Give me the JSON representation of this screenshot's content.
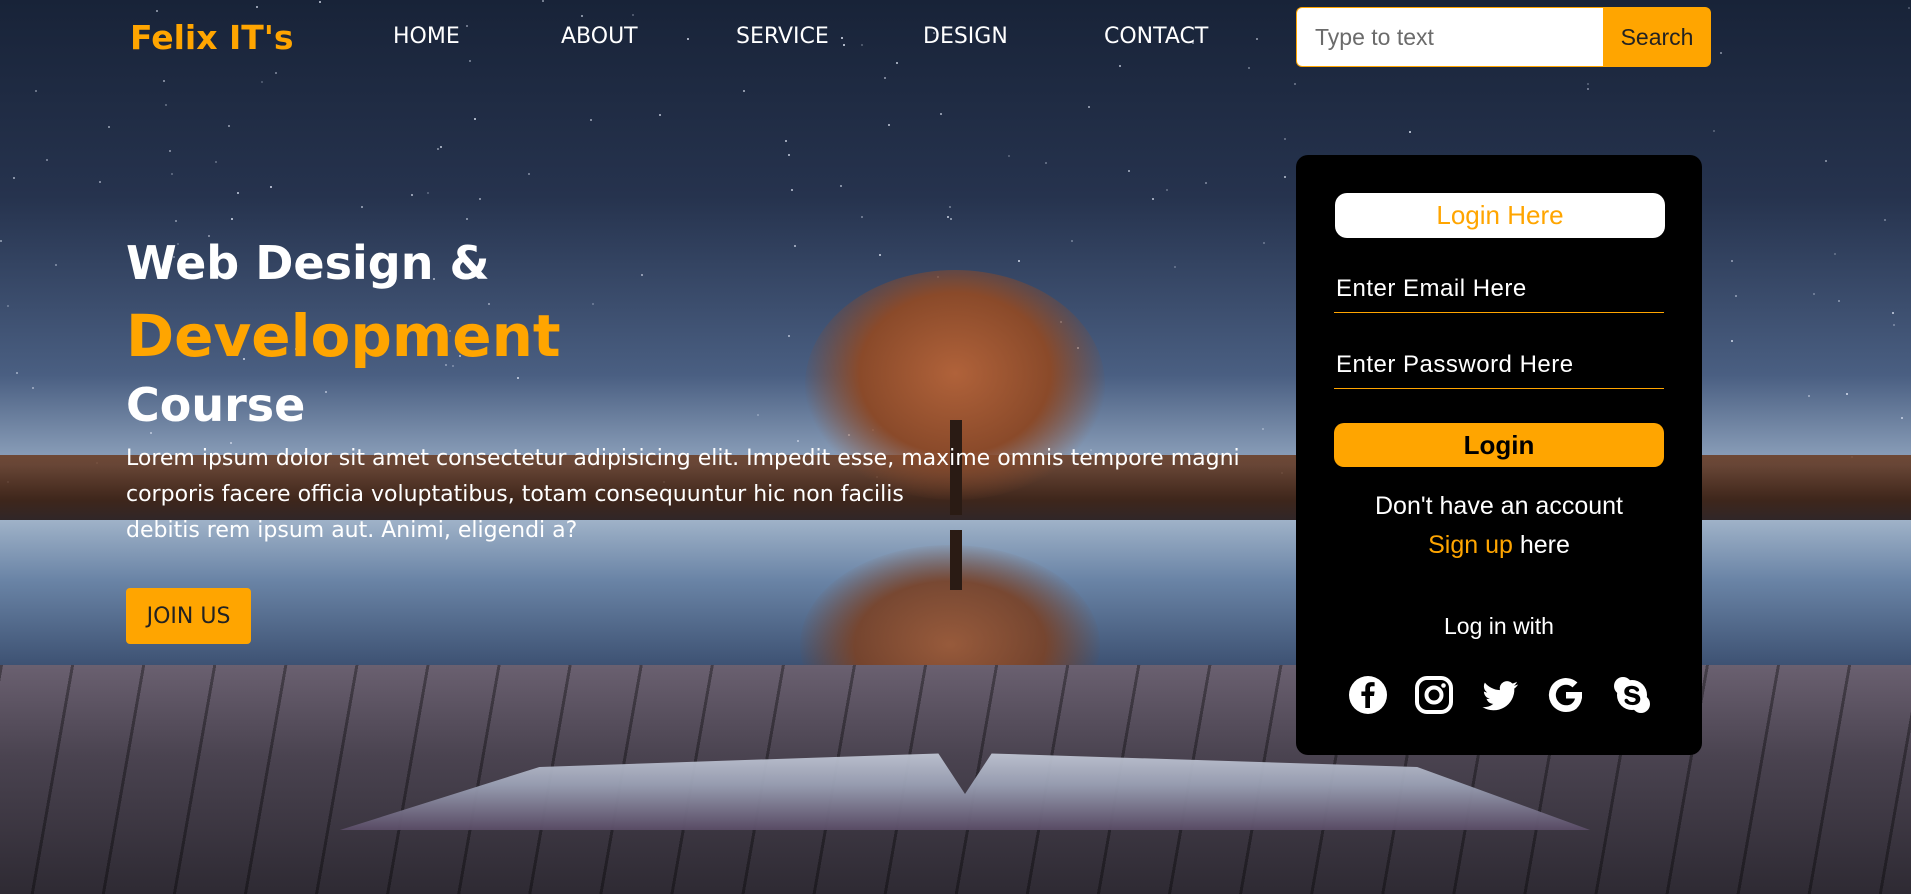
{
  "brand": "Felix IT's",
  "nav": {
    "items": [
      {
        "label": "HOME"
      },
      {
        "label": "ABOUT"
      },
      {
        "label": "SERVICE"
      },
      {
        "label": "DESIGN"
      },
      {
        "label": "CONTACT"
      }
    ]
  },
  "search": {
    "placeholder": "Type to text",
    "button_label": "Search"
  },
  "hero": {
    "line1": "Web Design &",
    "line2": "Development",
    "line3": "Course",
    "desc_lines": [
      "Lorem ipsum dolor sit amet consectetur adipisicing elit. Impedit esse, maxime omnis tempore magni",
      "corporis facere officia voluptatibus, totam consequuntur hic non facilis",
      "debitis rem ipsum aut. Animi, eligendi a?"
    ],
    "cta_label": "JOIN US"
  },
  "login": {
    "title": "Login Here",
    "email_placeholder": "Enter Email Here",
    "password_placeholder": "Enter Password Here",
    "button_label": "Login",
    "no_account": "Don't have an account",
    "signup_link": "Sign up",
    "signup_suffix": " here",
    "login_with": "Log in with",
    "socials": [
      "facebook-icon",
      "instagram-icon",
      "twitter-icon",
      "google-icon",
      "skype-icon"
    ]
  },
  "colors": {
    "accent": "#ffa500",
    "panel": "#000000",
    "text": "#ffffff"
  }
}
